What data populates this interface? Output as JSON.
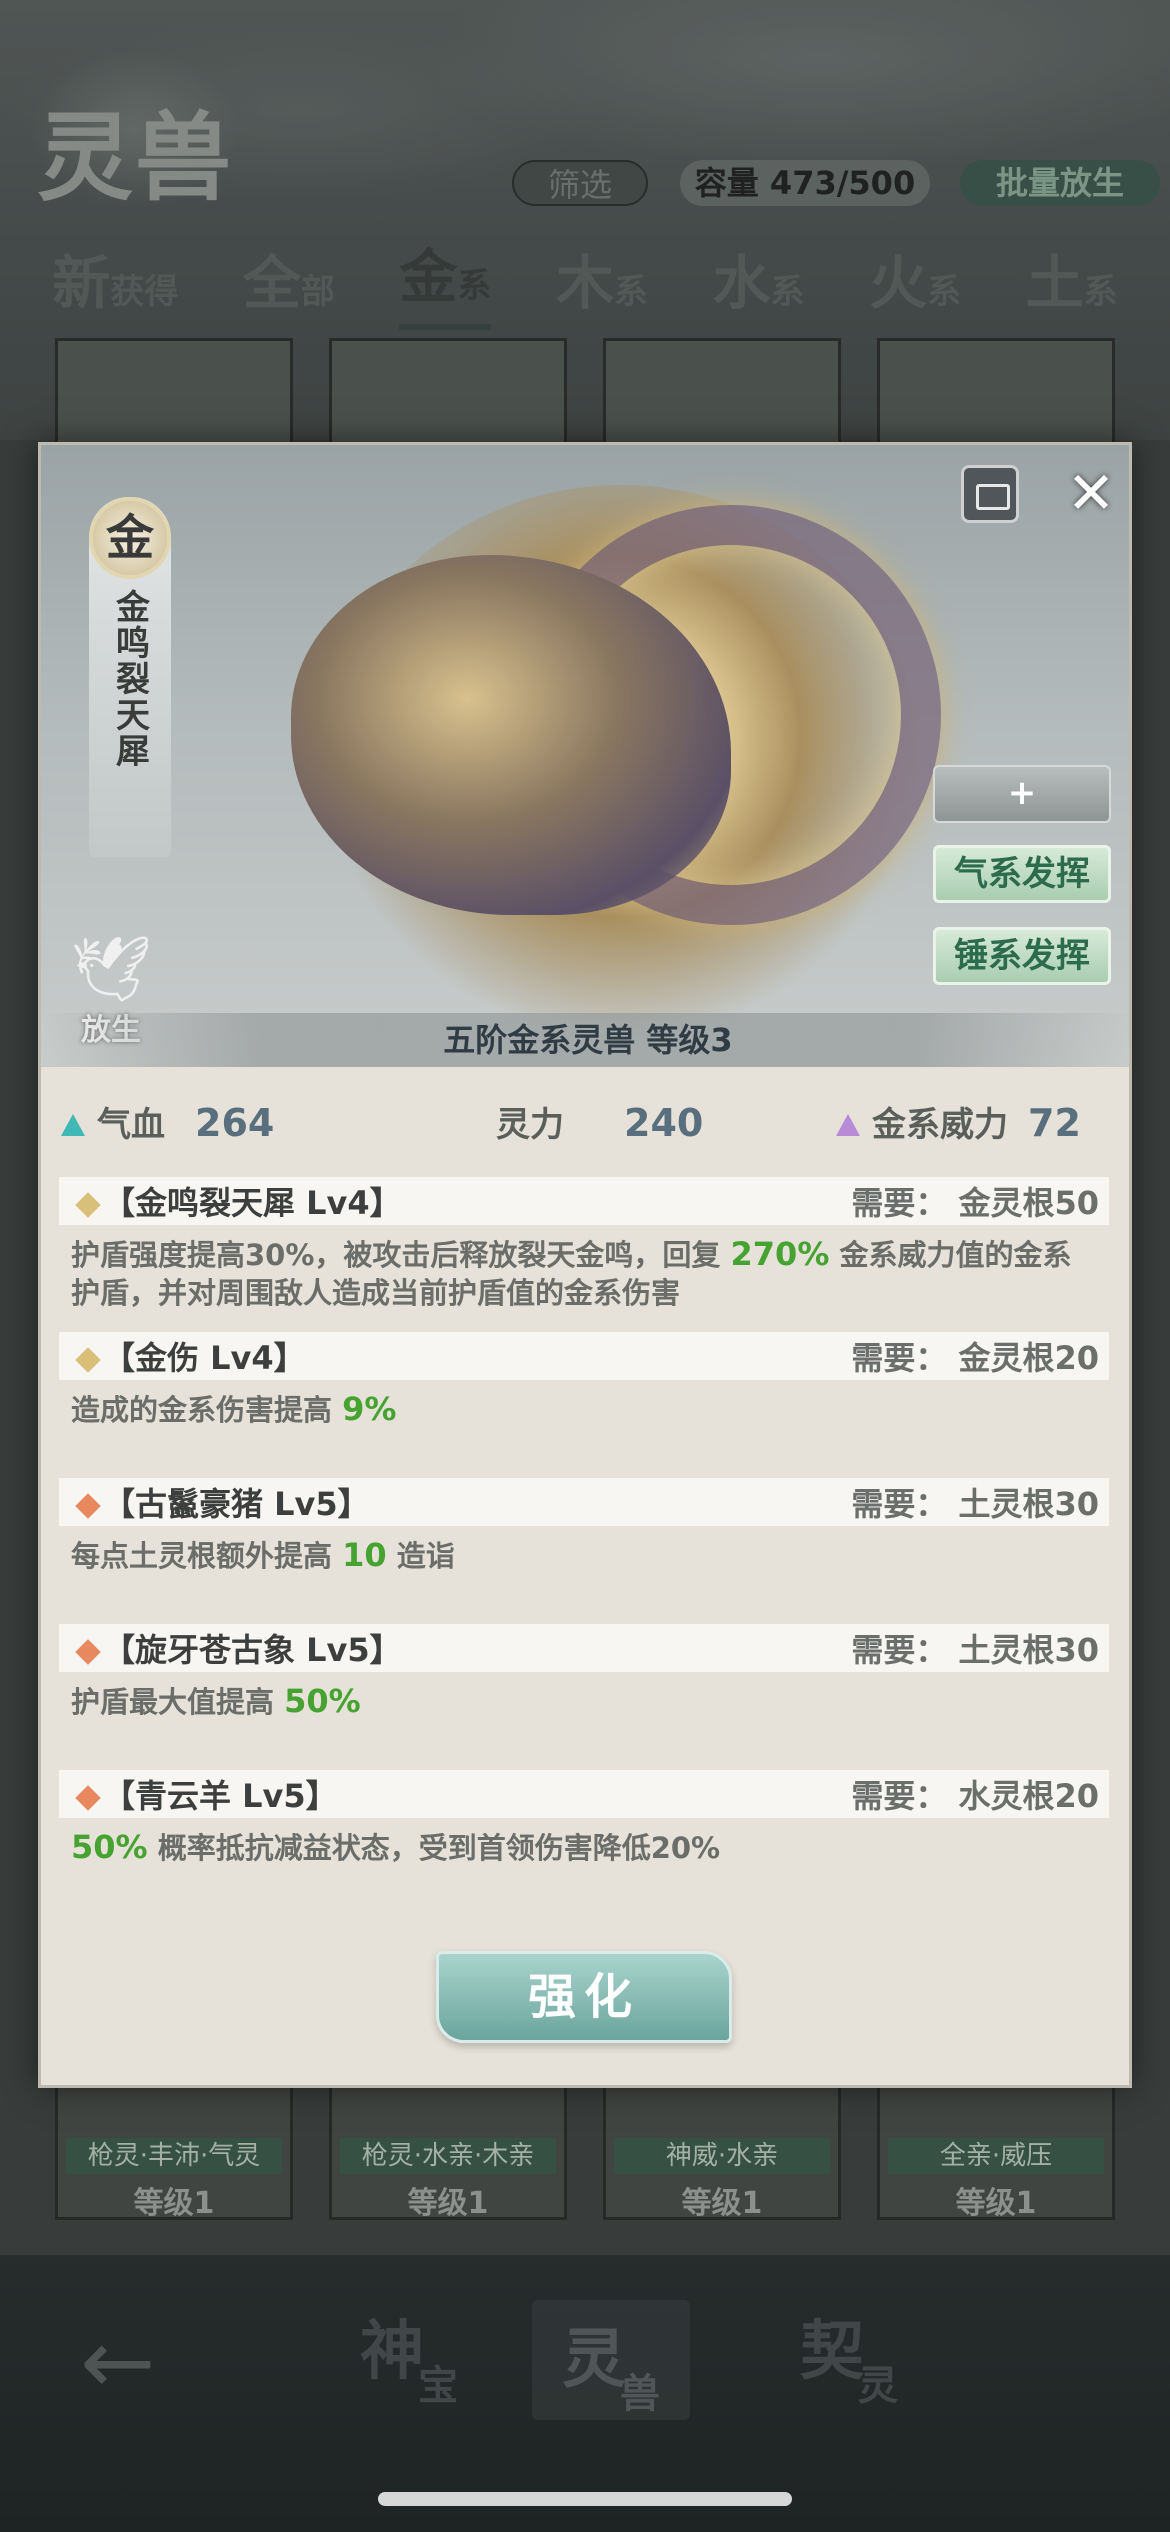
{
  "page": {
    "title": "灵兽",
    "filter_label": "筛选",
    "capacity_label": "容量 473/500",
    "bulk_release_label": "批量放生",
    "tabs": [
      {
        "main": "新",
        "sub": "获得"
      },
      {
        "main": "全",
        "sub": "部"
      },
      {
        "main": "金",
        "sub": "系"
      },
      {
        "main": "木",
        "sub": "系"
      },
      {
        "main": "水",
        "sub": "系"
      },
      {
        "main": "火",
        "sub": "系"
      },
      {
        "main": "土",
        "sub": "系"
      }
    ],
    "bottom_cards": [
      {
        "name": "枪灵·丰沛·气灵",
        "level": "等级1"
      },
      {
        "name": "枪灵·水亲·木亲",
        "level": "等级1"
      },
      {
        "name": "神威·水亲",
        "level": "等级1"
      },
      {
        "name": "全亲·威压",
        "level": "等级1"
      }
    ],
    "nav": [
      {
        "main": "神",
        "sub": "宝"
      },
      {
        "main": "灵",
        "sub": "兽"
      },
      {
        "main": "契",
        "sub": "灵"
      }
    ]
  },
  "modal": {
    "element_badge": "金",
    "beast_name": "金鸣裂天犀",
    "release_label": "放生",
    "plus_label": "+",
    "qi_label": "气系发挥",
    "hammer_label": "锤系发挥",
    "caption": "五阶金系灵兽    等级3",
    "stats": {
      "hp_label": "气血",
      "hp_value": "264",
      "spirit_label": "灵力",
      "spirit_value": "240",
      "gold_power_label": "金系威力",
      "gold_power_value": "72"
    },
    "skills": [
      {
        "name": "【金鸣裂天犀 Lv4】",
        "requirement": "需要：  金灵根50",
        "desc_pre": "护盾强度提高30%，被攻击后释放裂天金鸣，回复 ",
        "desc_hl": "270%",
        "desc_post": " 金系威力值的金系护盾，并对周围敌人造成当前护盾值的金系伤害"
      },
      {
        "name": "【金伤 Lv4】",
        "requirement": "需要：  金灵根20",
        "desc_pre": "造成的金系伤害提高 ",
        "desc_hl": "9%",
        "desc_post": ""
      },
      {
        "name": "【古鬣豪猪 Lv5】",
        "requirement": "需要：  土灵根30",
        "desc_pre": "每点土灵根额外提高 ",
        "desc_hl": "10",
        "desc_post": " 造诣"
      },
      {
        "name": "【旋牙苍古象 Lv5】",
        "requirement": "需要：  土灵根30",
        "desc_pre": "护盾最大值提高 ",
        "desc_hl": "50%",
        "desc_post": ""
      },
      {
        "name": "【青云羊 Lv5】",
        "requirement": "需要：  水灵根20",
        "desc_pre": "",
        "desc_hl": "50%",
        "desc_post": " 概率抵抗减益状态，受到首领伤害降低20%"
      }
    ],
    "enhance_label": "强化"
  },
  "colors": {
    "highlight": "#46a331",
    "accent_teal": "#3fb8b6",
    "accent_purple": "#b98ad6",
    "button_green_text": "#2c6b4c"
  },
  "icons": [
    "back-arrow-icon",
    "dove-icon",
    "chest-icon",
    "close-icon",
    "plus-icon"
  ]
}
